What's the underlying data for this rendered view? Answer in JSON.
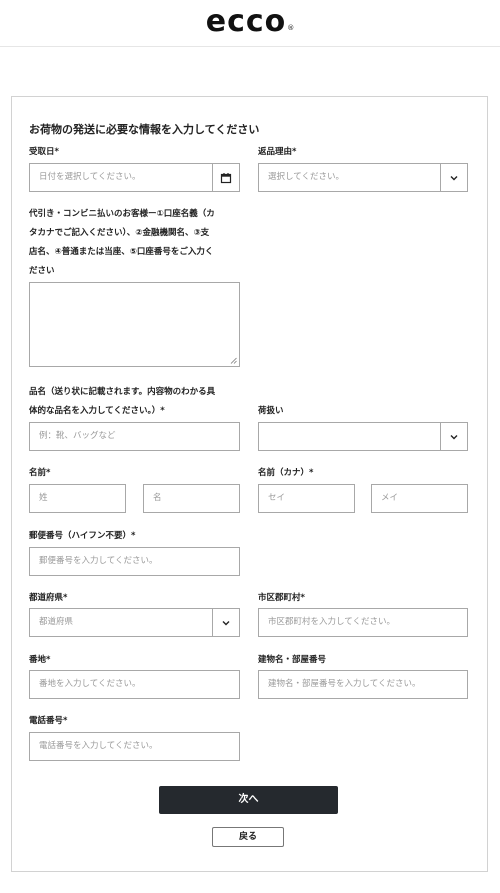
{
  "brand": {
    "logo_text": "ecco",
    "registered_mark": "®"
  },
  "form": {
    "heading": "お荷物の発送に必要な情報を入力してください",
    "receipt_date": {
      "label": "受取日*",
      "placeholder": "日付を選択してください。",
      "icon": "calendar-icon"
    },
    "return_reason": {
      "label": "返品理由*",
      "placeholder": "選択してください。",
      "icon": "chevron-down-icon"
    },
    "cod_note": {
      "lines": [
        "代引き・コンビニ払いのお客様ー①口座名義（カ",
        "タカナでご記入ください）、②金融機関名、③支",
        "店名、④普通または当座、⑤口座番号をご入力く",
        "ださい"
      ]
    },
    "item_name": {
      "label_lines": [
        "品名（送り状に記載されます。内容物のわかる具",
        "体的な品名を入力してください。）*"
      ],
      "placeholder": "例：靴、バッグなど"
    },
    "handling": {
      "label": "荷扱い",
      "value": "",
      "icon": "chevron-down-icon"
    },
    "name": {
      "label": "名前*",
      "last_placeholder": "姓",
      "first_placeholder": "名"
    },
    "name_kana": {
      "label": "名前（カナ）*",
      "last_placeholder": "セイ",
      "first_placeholder": "メイ"
    },
    "postal_code": {
      "label": "郵便番号（ハイフン不要）*",
      "placeholder": "郵便番号を入力してください。"
    },
    "prefecture": {
      "label": "都道府県*",
      "placeholder": "都道府県",
      "icon": "chevron-down-icon"
    },
    "city": {
      "label": "市区郡町村*",
      "placeholder": "市区郡町村を入力してください。"
    },
    "address": {
      "label": "番地*",
      "placeholder": "番地を入力してください。"
    },
    "building": {
      "label": "建物名・部屋番号",
      "placeholder": "建物名・部屋番号を入力してください。"
    },
    "phone": {
      "label": "電話番号*",
      "placeholder": "電話番号を入力してください。"
    }
  },
  "buttons": {
    "next_label": "次へ",
    "back_label": "戻る"
  },
  "colors": {
    "primary_button": "#25292e",
    "border": "#a8a8a8",
    "placeholder": "#9a9a9a"
  }
}
